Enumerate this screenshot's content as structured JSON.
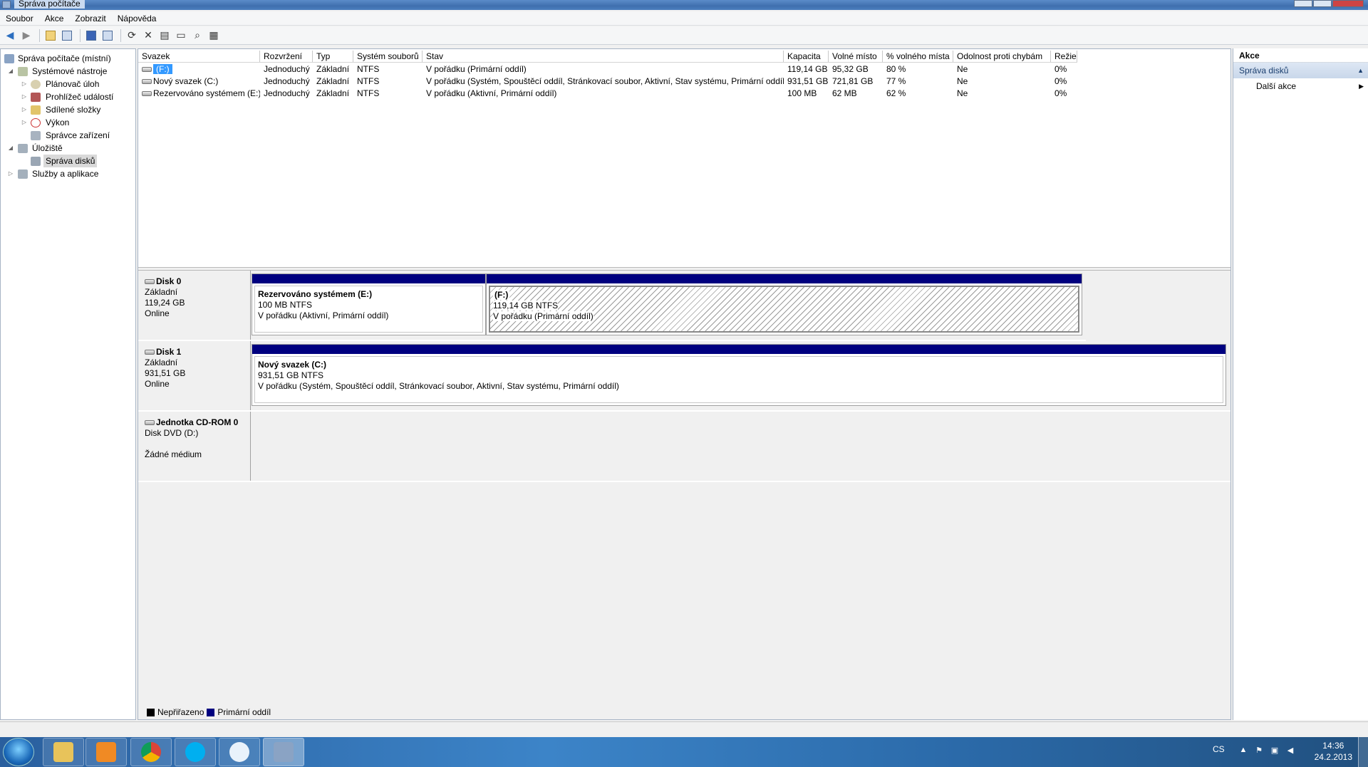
{
  "window": {
    "title": "Správa počítače"
  },
  "menu": [
    "Soubor",
    "Akce",
    "Zobrazit",
    "Nápověda"
  ],
  "toolbar_icons": [
    "back-icon",
    "forward-icon",
    "up-folder-icon",
    "show-hide-tree-icon",
    "help-icon",
    "properties-panel-icon",
    "refresh-icon",
    "delete-icon",
    "properties-icon",
    "open-icon",
    "search-icon",
    "settings-icon"
  ],
  "tree": [
    {
      "label": "Správa počítače (místní)",
      "icon": "computer-management-icon",
      "level": 0,
      "expand": ""
    },
    {
      "label": "Systémové nástroje",
      "icon": "tools-icon",
      "level": 1,
      "expand": "◢"
    },
    {
      "label": "Plánovač úloh",
      "icon": "clock-icon",
      "level": 2,
      "expand": "▷"
    },
    {
      "label": "Prohlížeč událostí",
      "icon": "event-viewer-icon",
      "level": 2,
      "expand": "▷"
    },
    {
      "label": "Sdílené složky",
      "icon": "shared-folder-icon",
      "level": 2,
      "expand": "▷"
    },
    {
      "label": "Výkon",
      "icon": "performance-icon",
      "level": 2,
      "expand": "▷"
    },
    {
      "label": "Správce zařízení",
      "icon": "device-manager-icon",
      "level": 2,
      "expand": ""
    },
    {
      "label": "Úložiště",
      "icon": "storage-icon",
      "level": 1,
      "expand": "◢"
    },
    {
      "label": "Správa disků",
      "icon": "disk-management-icon",
      "level": 2,
      "expand": "",
      "selected": true
    },
    {
      "label": "Služby a aplikace",
      "icon": "services-icon",
      "level": 1,
      "expand": "▷"
    }
  ],
  "volumes": {
    "headers": [
      "Svazek",
      "Rozvržení",
      "Typ",
      "Systém souborů",
      "Stav",
      "Kapacita",
      "Volné místo",
      "% volného místa",
      "Odolnost proti chybám",
      "Režie"
    ],
    "rows": [
      [
        "(F:)",
        "Jednoduchý",
        "Základní",
        "NTFS",
        "V pořádku (Primární oddíl)",
        "119,14 GB",
        "95,32 GB",
        "80 %",
        "Ne",
        "0%"
      ],
      [
        "Nový svazek (C:)",
        "Jednoduchý",
        "Základní",
        "NTFS",
        "V pořádku (Systém, Spouštěcí oddíl, Stránkovací soubor, Aktivní, Stav systému, Primární oddíl)",
        "931,51 GB",
        "721,81 GB",
        "77 %",
        "Ne",
        "0%"
      ],
      [
        "Rezervováno systémem (E:)",
        "Jednoduchý",
        "Základní",
        "NTFS",
        "V pořádku (Aktivní, Primární oddíl)",
        "100 MB",
        "62 MB",
        "62 %",
        "Ne",
        "0%"
      ]
    ]
  },
  "disks": [
    {
      "name": "Disk 0",
      "type": "Základní",
      "size": "119,24 GB",
      "status": "Online",
      "partitions": [
        {
          "name": "Rezervováno systémem  (E:)",
          "size": "100 MB NTFS",
          "status": "V pořádku (Aktivní, Primární oddíl)"
        },
        {
          "name": "(F:)",
          "size": "119,14 GB NTFS",
          "status": "V pořádku (Primární oddíl)"
        }
      ]
    },
    {
      "name": "Disk 1",
      "type": "Základní",
      "size": "931,51 GB",
      "status": "Online",
      "partitions": [
        {
          "name": "Nový svazek  (C:)",
          "size": "931,51 GB NTFS",
          "status": "V pořádku (Systém, Spouštěcí oddíl, Stránkovací soubor, Aktivní, Stav systému, Primární oddíl)"
        }
      ]
    },
    {
      "name": "Jednotka CD-ROM 0",
      "type": "Disk DVD (D:)",
      "size": "",
      "status": "Žádné médium",
      "partitions": []
    }
  ],
  "legend": [
    {
      "label": "Nepřiřazeno",
      "color": "#000000"
    },
    {
      "label": "Primární oddíl",
      "color": "#00007f"
    }
  ],
  "actions": {
    "header": "Akce",
    "section": "Správa disků",
    "items": [
      "Další akce"
    ]
  },
  "taskbar": {
    "apps": [
      "explorer-icon",
      "media-player-icon",
      "chrome-icon",
      "skype-icon",
      "uplay-icon",
      "computer-management-icon"
    ],
    "lang": "CS",
    "time": "14:36",
    "date": "24.2.2013"
  },
  "colors": {
    "primary_partition": "#00007f",
    "selection": "#3399ff"
  }
}
